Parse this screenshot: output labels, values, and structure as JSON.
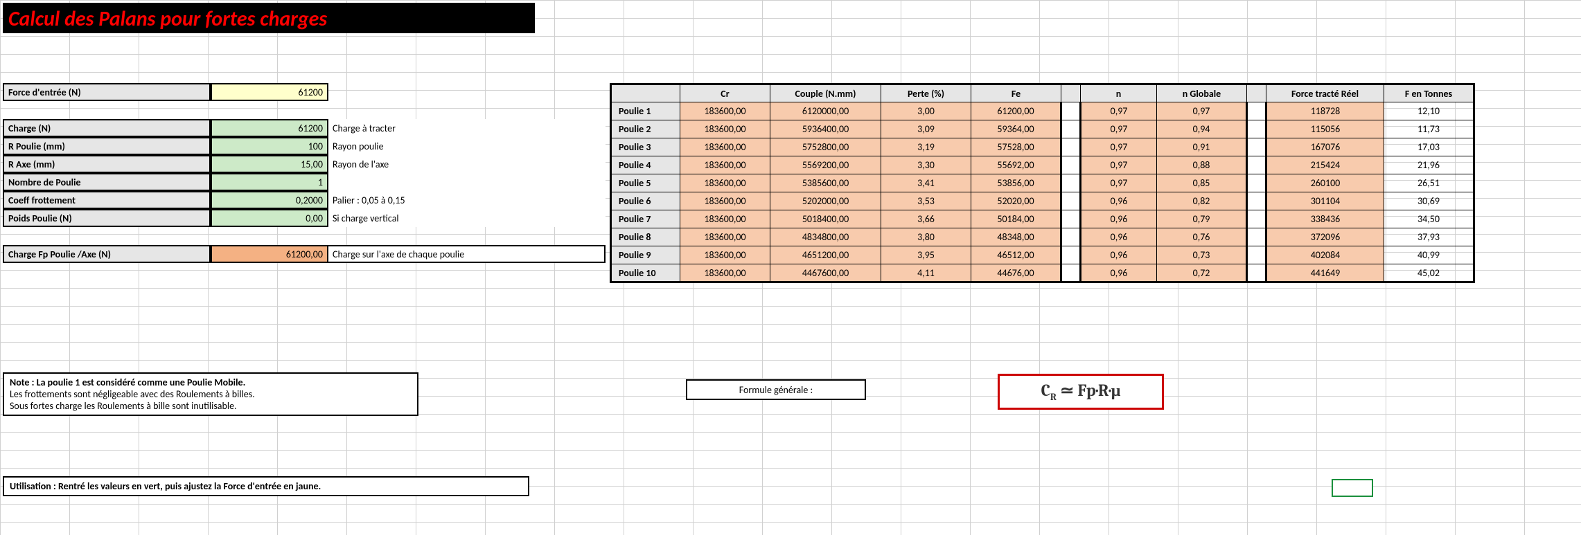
{
  "title": "Calcul des Palans pour fortes charges",
  "inputs": {
    "force_entree": {
      "label": "Force d'entrée (N)",
      "value": "61200"
    },
    "charge": {
      "label": "Charge (N)",
      "value": "61200",
      "note": "Charge à tracter"
    },
    "r_poulie": {
      "label": "R Poulie (mm)",
      "value": "100",
      "note": "Rayon poulie"
    },
    "r_axe": {
      "label": "R Axe (mm)",
      "value": "15,00",
      "note": "Rayon de l'axe"
    },
    "nb_poulie": {
      "label": "Nombre de Poulie",
      "value": "1",
      "note": ""
    },
    "coeff": {
      "label": "Coeff frottement",
      "value": "0,2000",
      "note": "Palier : 0,05 à 0,15"
    },
    "poids": {
      "label": "Poids Poulie (N)",
      "value": "0,00",
      "note": "Si charge vertical"
    },
    "fp_axe": {
      "label": "Charge Fp Poulie /Axe (N)",
      "value": "61200,00",
      "note": "Charge sur l'axe de chaque poulie"
    }
  },
  "headers": {
    "row": "",
    "cr": "Cr",
    "couple": "Couple (N.mm)",
    "perte": "Perte (%)",
    "fe": "Fe",
    "gap": "",
    "n": "n",
    "ng": "n Globale",
    "ftr": "Force tracté Réel",
    "ft": "F en Tonnes"
  },
  "rows": [
    {
      "name": "Poulie 1",
      "cr": "183600,00",
      "couple": "6120000,00",
      "perte": "3,00",
      "fe": "61200,00",
      "n": "0,97",
      "ng": "0,97",
      "ftr": "118728",
      "ft": "12,10"
    },
    {
      "name": "Poulie 2",
      "cr": "183600,00",
      "couple": "5936400,00",
      "perte": "3,09",
      "fe": "59364,00",
      "n": "0,97",
      "ng": "0,94",
      "ftr": "115056",
      "ft": "11,73"
    },
    {
      "name": "Poulie 3",
      "cr": "183600,00",
      "couple": "5752800,00",
      "perte": "3,19",
      "fe": "57528,00",
      "n": "0,97",
      "ng": "0,91",
      "ftr": "167076",
      "ft": "17,03"
    },
    {
      "name": "Poulie 4",
      "cr": "183600,00",
      "couple": "5569200,00",
      "perte": "3,30",
      "fe": "55692,00",
      "n": "0,97",
      "ng": "0,88",
      "ftr": "215424",
      "ft": "21,96"
    },
    {
      "name": "Poulie 5",
      "cr": "183600,00",
      "couple": "5385600,00",
      "perte": "3,41",
      "fe": "53856,00",
      "n": "0,97",
      "ng": "0,85",
      "ftr": "260100",
      "ft": "26,51"
    },
    {
      "name": "Poulie 6",
      "cr": "183600,00",
      "couple": "5202000,00",
      "perte": "3,53",
      "fe": "52020,00",
      "n": "0,96",
      "ng": "0,82",
      "ftr": "301104",
      "ft": "30,69"
    },
    {
      "name": "Poulie 7",
      "cr": "183600,00",
      "couple": "5018400,00",
      "perte": "3,66",
      "fe": "50184,00",
      "n": "0,96",
      "ng": "0,79",
      "ftr": "338436",
      "ft": "34,50"
    },
    {
      "name": "Poulie 8",
      "cr": "183600,00",
      "couple": "4834800,00",
      "perte": "3,80",
      "fe": "48348,00",
      "n": "0,96",
      "ng": "0,76",
      "ftr": "372096",
      "ft": "37,93"
    },
    {
      "name": "Poulie 9",
      "cr": "183600,00",
      "couple": "4651200,00",
      "perte": "3,95",
      "fe": "46512,00",
      "n": "0,96",
      "ng": "0,73",
      "ftr": "402084",
      "ft": "40,99"
    },
    {
      "name": "Poulie 10",
      "cr": "183600,00",
      "couple": "4467600,00",
      "perte": "4,11",
      "fe": "44676,00",
      "n": "0,96",
      "ng": "0,72",
      "ftr": "441649",
      "ft": "45,02"
    }
  ],
  "notes": {
    "line1": "Note : La poulie 1 est considéré comme une Poulie Mobile.",
    "line2": "Les frottements sont négligeable avec des Roulements à billes.",
    "line3": "Sous fortes charge les Roulements à bille sont inutilisable.",
    "usage": "Utilisation : Rentré les valeurs en vert, puis ajustez la Force d'entrée en jaune."
  },
  "formula": {
    "label": "Formule générale :",
    "text": "Cʀ ≃ Fp·R·μ"
  },
  "chart_data": {
    "type": "table",
    "title": "Résultats palans",
    "columns": [
      "Poulie",
      "Cr",
      "Couple (N.mm)",
      "Perte (%)",
      "Fe",
      "n",
      "n Globale",
      "Force tracté Réel",
      "F en Tonnes"
    ],
    "data": [
      [
        "Poulie 1",
        183600.0,
        6120000.0,
        3.0,
        61200.0,
        0.97,
        0.97,
        118728,
        12.1
      ],
      [
        "Poulie 2",
        183600.0,
        5936400.0,
        3.09,
        59364.0,
        0.97,
        0.94,
        115056,
        11.73
      ],
      [
        "Poulie 3",
        183600.0,
        5752800.0,
        3.19,
        57528.0,
        0.97,
        0.91,
        167076,
        17.03
      ],
      [
        "Poulie 4",
        183600.0,
        5569200.0,
        3.3,
        55692.0,
        0.97,
        0.88,
        215424,
        21.96
      ],
      [
        "Poulie 5",
        183600.0,
        5385600.0,
        3.41,
        53856.0,
        0.97,
        0.85,
        260100,
        26.51
      ],
      [
        "Poulie 6",
        183600.0,
        5202000.0,
        3.53,
        52020.0,
        0.96,
        0.82,
        301104,
        30.69
      ],
      [
        "Poulie 7",
        183600.0,
        5018400.0,
        3.66,
        50184.0,
        0.96,
        0.79,
        338436,
        34.5
      ],
      [
        "Poulie 8",
        183600.0,
        4834800.0,
        3.8,
        48348.0,
        0.96,
        0.76,
        372096,
        37.93
      ],
      [
        "Poulie 9",
        183600.0,
        4651200.0,
        3.95,
        46512.0,
        0.96,
        0.73,
        402084,
        40.99
      ],
      [
        "Poulie 10",
        183600.0,
        4467600.0,
        4.11,
        44676.0,
        0.96,
        0.72,
        441649,
        45.02
      ]
    ]
  }
}
